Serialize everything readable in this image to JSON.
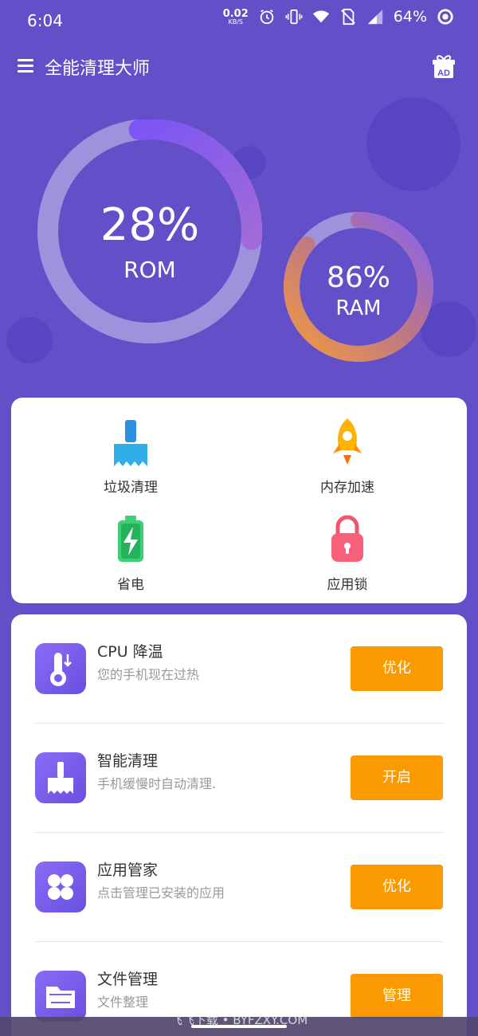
{
  "status_bar": {
    "time": "6:04",
    "net_speed": "0.02",
    "net_unit": "KB/S",
    "battery": "64%"
  },
  "app_bar": {
    "title": "全能清理大师",
    "menu_icon": "menu-icon",
    "ad_icon": "gift-ad-icon",
    "ad_text": "AD"
  },
  "gauges": {
    "rom": {
      "percent": "28%",
      "label": "ROM",
      "value": 0.28
    },
    "ram": {
      "percent": "86%",
      "label": "RAM",
      "value": 0.86
    }
  },
  "tools": [
    {
      "label": "垃圾清理",
      "icon": "broom-icon"
    },
    {
      "label": "内存加速",
      "icon": "rocket-icon"
    },
    {
      "label": "省电",
      "icon": "battery-icon"
    },
    {
      "label": "应用锁",
      "icon": "lock-icon"
    }
  ],
  "features": [
    {
      "title": "CPU 降温",
      "subtitle": "您的手机现在过热",
      "button": "优化",
      "icon": "thermometer-icon"
    },
    {
      "title": "智能清理",
      "subtitle": "手机缓慢时自动清理.",
      "button": "开启",
      "icon": "broom-icon"
    },
    {
      "title": "应用管家",
      "subtitle": "点击管理已安装的应用",
      "button": "优化",
      "icon": "apps-grid-icon"
    },
    {
      "title": "文件管理",
      "subtitle": "文件整理",
      "button": "管理",
      "icon": "folder-icon"
    }
  ],
  "watermark": "飞飞下载 • BYFZXY.COM",
  "colors": {
    "background": "#6350c9",
    "accent_button": "#fb9a00",
    "rom_arc": "#8a63f0",
    "ram_arc_start": "#f19a3e",
    "ram_arc_end": "#8a63f0"
  }
}
